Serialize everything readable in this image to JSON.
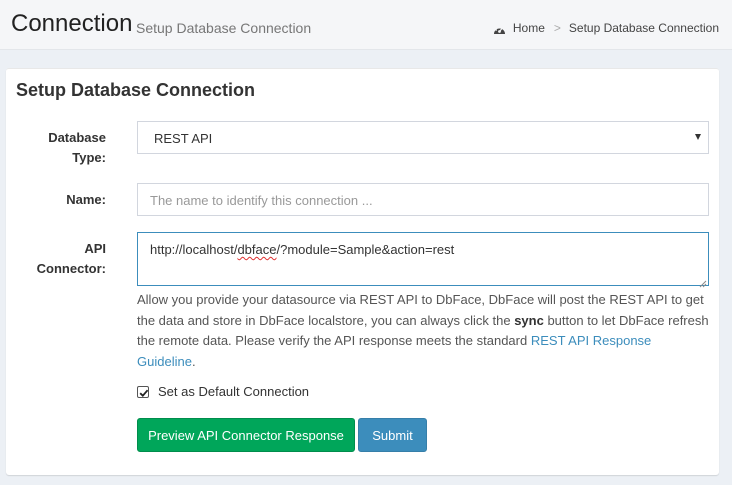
{
  "header": {
    "title": "Connection",
    "subtitle": "Setup Database Connection",
    "breadcrumb": {
      "home_label": "Home",
      "separator": ">",
      "current_label": "Setup Database Connection"
    }
  },
  "form": {
    "title": "Setup Database Connection",
    "database_type": {
      "label_line1": "Database",
      "label_line2": "Type:",
      "value": "REST API"
    },
    "name": {
      "label": "Name:",
      "placeholder": "The name to identify this connection ..."
    },
    "api_connector": {
      "label_line1": "API",
      "label_line2": "Connector:",
      "value_part1": "http://localhost/",
      "value_part2": "dbface",
      "value_part3": "/?module=Sample&action=rest"
    },
    "help": {
      "text_before": "Allow you provide your datasource via REST API to DbFace, DbFace will post the REST API to get the data and store in DbFace localstore, you can always click the ",
      "bold_word": "sync",
      "text_middle": " button to let DbFace refresh the remote data. Please verify the API response meets the standard ",
      "link_text": "REST API Response Guideline",
      "text_after": "."
    },
    "default_connection": {
      "label": "Set as Default Connection",
      "checked": true
    },
    "buttons": {
      "preview_label": "Preview API Connector Response",
      "submit_label": "Submit"
    }
  },
  "colors": {
    "preview_button": "#00a65a",
    "submit_button": "#3c8dbc",
    "link": "#3c8dbc",
    "background": "#ecf0f5"
  },
  "icons": {
    "breadcrumb_home": "dashboard-icon",
    "select_caret": "caret-down-icon",
    "checkbox": "checkmark-icon"
  }
}
